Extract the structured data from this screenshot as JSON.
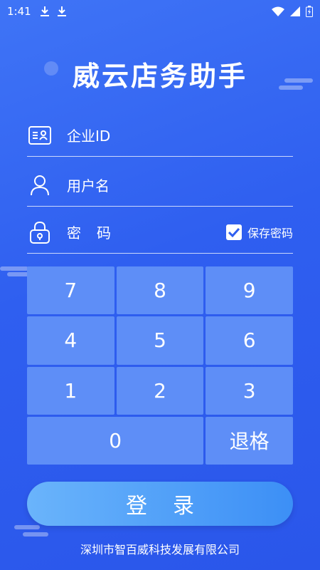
{
  "status_bar": {
    "time": "1:41",
    "icons": [
      "download-icon",
      "download-icon",
      "wifi-icon",
      "signal-icon",
      "battery-charging-icon"
    ]
  },
  "app": {
    "title": "威云店务助手"
  },
  "form": {
    "company_id_placeholder": "企业ID",
    "username_placeholder": "用户名",
    "password_placeholder": "密码",
    "save_password_label": "保存密码",
    "save_password_checked": true
  },
  "keypad": {
    "keys": [
      "7",
      "8",
      "9",
      "4",
      "5",
      "6",
      "1",
      "2",
      "3"
    ],
    "zero": "0",
    "backspace": "退格"
  },
  "login_button": "登录",
  "footer": "深圳市智百威科技发展有限公司",
  "colors": {
    "background": "#2f5ff0",
    "key": "#5e8ef7",
    "button_start": "#6ab4fb",
    "button_end": "#3c8ff6"
  }
}
